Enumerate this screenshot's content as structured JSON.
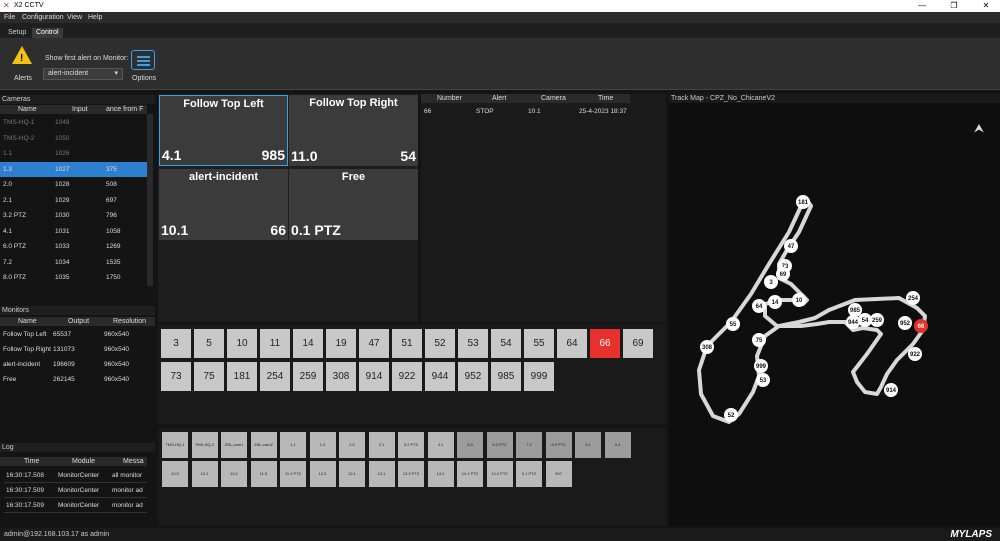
{
  "window": {
    "title": "X2 CCTV"
  },
  "menu": [
    "File",
    "Configuration",
    "View",
    "Help"
  ],
  "tabs": [
    "Setup",
    "Control"
  ],
  "ribbon": {
    "alerts_label": "Alerts",
    "show_alert_label": "Show first alert on Monitor:",
    "monitor_value": "alert-incident",
    "options_label": "Options"
  },
  "cameras": {
    "title": "Cameras",
    "headers": [
      "Name",
      "Input",
      "ance from F"
    ],
    "rows": [
      {
        "name": "TMS-HQ-1",
        "input": "1049",
        "dist": ""
      },
      {
        "name": "TMS-HQ-2",
        "input": "1050",
        "dist": ""
      },
      {
        "name": "1.1",
        "input": "1026",
        "dist": ""
      },
      {
        "name": "1.3",
        "input": "1027",
        "dist": "375"
      },
      {
        "name": "2.0",
        "input": "1028",
        "dist": "508"
      },
      {
        "name": "2.1",
        "input": "1029",
        "dist": "697"
      },
      {
        "name": "3.2 PTZ",
        "input": "1030",
        "dist": "796"
      },
      {
        "name": "4.1",
        "input": "1031",
        "dist": "1058"
      },
      {
        "name": "6.0 PTZ",
        "input": "1033",
        "dist": "1269"
      },
      {
        "name": "7.2",
        "input": "1034",
        "dist": "1535"
      },
      {
        "name": "8.0 PTZ",
        "input": "1035",
        "dist": "1750"
      }
    ]
  },
  "monitors": {
    "title": "Monitors",
    "headers": [
      "Name",
      "Output",
      "Resolution"
    ],
    "rows": [
      {
        "name": "Follow Top Left",
        "output": "65537",
        "res": "960x540"
      },
      {
        "name": "Follow Top Right",
        "output": "131073",
        "res": "960x540"
      },
      {
        "name": "alert-incident",
        "output": "196609",
        "res": "960x540"
      },
      {
        "name": "Free",
        "output": "262145",
        "res": "960x540"
      }
    ]
  },
  "log": {
    "title": "Log",
    "headers": [
      "Time",
      "Module",
      "Messa"
    ],
    "rows": [
      {
        "time": "16:30:17.508",
        "module": "MonitorCenter",
        "msg": "all monitor"
      },
      {
        "time": "16:30:17.509",
        "module": "MonitorCenter",
        "msg": "monitor ad"
      },
      {
        "time": "16:30:17.509",
        "module": "MonitorCenter",
        "msg": "monitor ad"
      }
    ]
  },
  "monitor_tiles": [
    {
      "title": "Follow Top Left",
      "left": "4.1",
      "right": "985"
    },
    {
      "title": "Follow Top Right",
      "left": "11.0",
      "right": "54"
    },
    {
      "title": "alert-incident",
      "left": "10.1",
      "right": "66"
    },
    {
      "title": "Free",
      "left": "0.1 PTZ",
      "right": ""
    }
  ],
  "alerts": {
    "headers": [
      "Number",
      "Alert",
      "Camera",
      "Time"
    ],
    "rows": [
      {
        "number": "66",
        "alert": "STOP",
        "camera": "10.1",
        "time": "25-4-2023 18:37"
      }
    ]
  },
  "transponders": {
    "items": [
      "3",
      "5",
      "10",
      "11",
      "14",
      "19",
      "47",
      "51",
      "52",
      "53",
      "54",
      "55",
      "64",
      "66",
      "69",
      "73",
      "75",
      "181",
      "254",
      "259",
      "308",
      "914",
      "922",
      "944",
      "952",
      "985",
      "999"
    ],
    "highlight": "66",
    "highlight_color": "#e8302c"
  },
  "camera_buttons": {
    "row1": [
      "TMS-HQ-1",
      "TMS-HQ-2",
      "ZNL-cam1",
      "ZNL-cam2",
      "1.1",
      "1.3",
      "2.0",
      "2.1",
      "3.2 PTZ",
      "4.1",
      "5.0",
      "6.0 PTZ",
      "7.2",
      "8.0 PTZ",
      "9.1",
      "9.4"
    ],
    "row2": [
      "10.0",
      "10.1",
      "10.2",
      "11.0",
      "11.1 PTZ",
      "12.0",
      "12.1",
      "13.1",
      "13.2 PTZ",
      "14.0",
      "14.1 PTZ",
      "14.2 PTZ",
      "0.1 PTZ",
      "997"
    ]
  },
  "map": {
    "title": "Track Map - CPZ_No_ChicaneV2",
    "north_icon": "north-arrow-icon",
    "points": [
      "181",
      "47",
      "73",
      "69",
      "3",
      "64",
      "14",
      "10",
      "55",
      "985",
      "944",
      "54",
      "259",
      "254",
      "952",
      "66",
      "308",
      "75",
      "999",
      "53",
      "922",
      "914",
      "52"
    ],
    "highlight": "66"
  },
  "status": {
    "user": "admin@192.168.103.17 as admin",
    "brand": "MYLAPS"
  }
}
